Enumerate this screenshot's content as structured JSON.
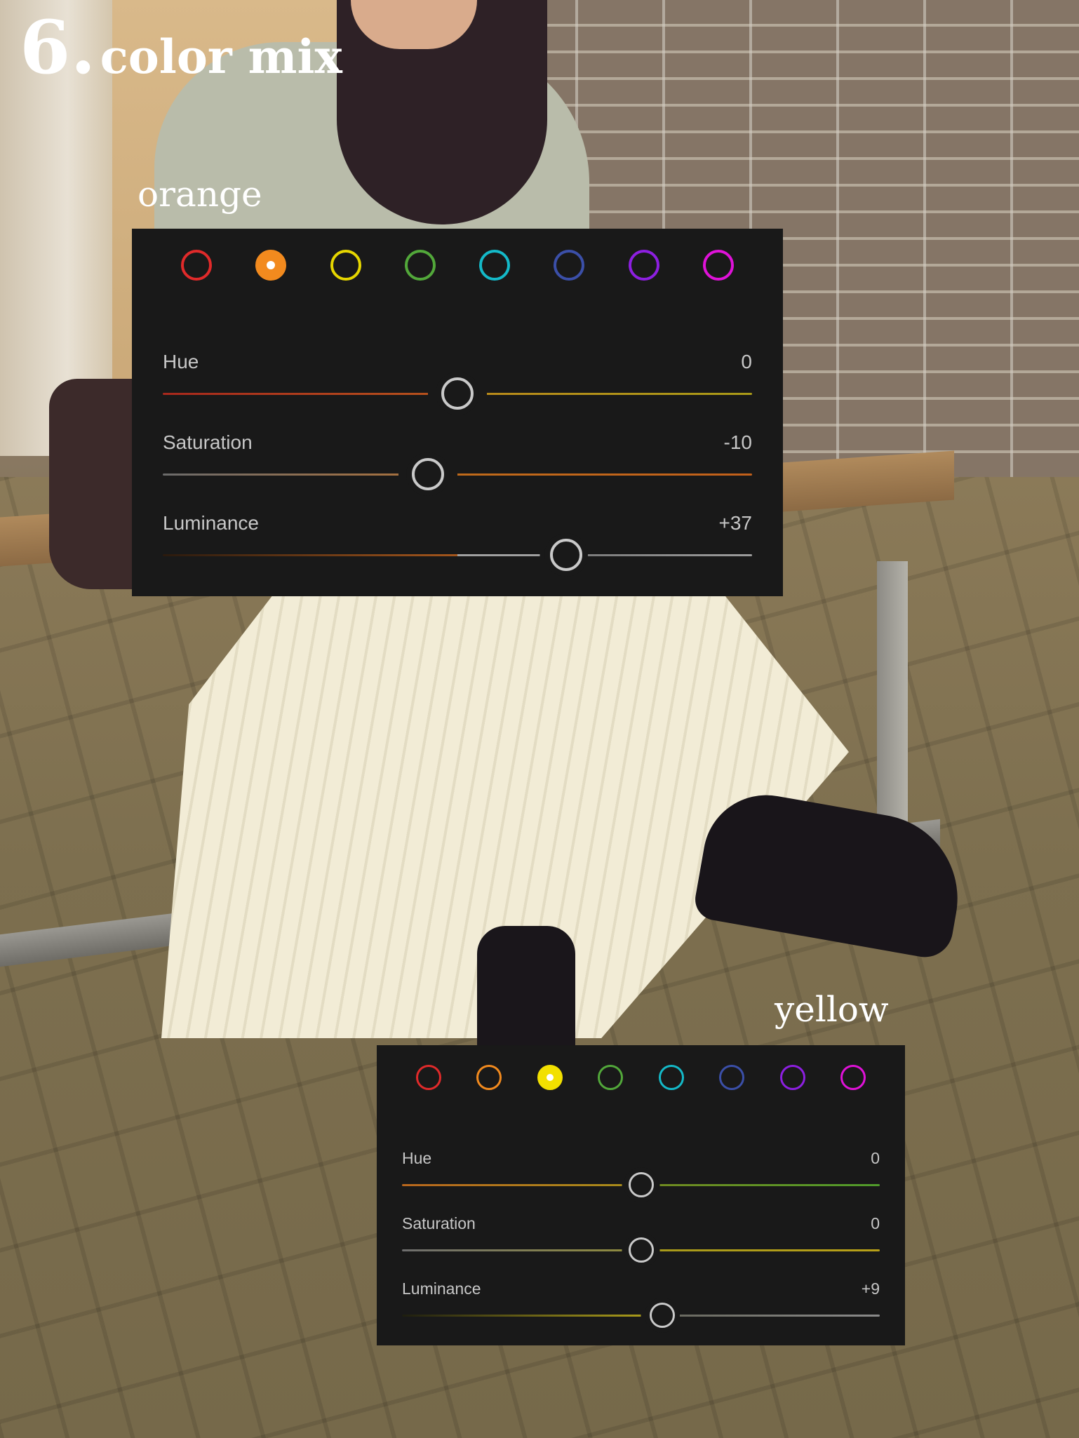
{
  "heading": {
    "number": "6.",
    "text": "color mix"
  },
  "panels": [
    {
      "label": "orange",
      "selected": "orange",
      "swatches": [
        {
          "name": "red",
          "color": "#e02a2a"
        },
        {
          "name": "orange",
          "color": "#f28a1e"
        },
        {
          "name": "yellow",
          "color": "#e6d600"
        },
        {
          "name": "green",
          "color": "#52a83a"
        },
        {
          "name": "aqua",
          "color": "#14b9c8"
        },
        {
          "name": "blue",
          "color": "#3b4fa8"
        },
        {
          "name": "purple",
          "color": "#8d1fe0"
        },
        {
          "name": "magenta",
          "color": "#df12d8"
        }
      ],
      "sliders": [
        {
          "label": "Hue",
          "value": "0",
          "fraction": 0.5,
          "track": "linear-gradient(90deg, #a8281c 0%, #b5501c 45%, #191919 45%, #191919 55%, #b88a1a 55%, #a99a18 100%)"
        },
        {
          "label": "Saturation",
          "value": "-10",
          "fraction": 0.45,
          "track": "linear-gradient(90deg, #6b6b6b 0%, #a47040 40%, #191919 40%, #191919 50%, #bf6a1a 50%, #c2601a 100%)"
        },
        {
          "label": "Luminance",
          "value": "+37",
          "fraction": 0.685,
          "track": "linear-gradient(90deg, #2a1a0e 0%, #a4561c 50%, #a0a0a0 50%, #a0a0a0 64%, #191919 64%, #191919 72%, #7c7c7c 72%, #9c9c9c 100%)"
        }
      ]
    },
    {
      "label": "yellow",
      "selected": "yellow",
      "swatches": [
        {
          "name": "red",
          "color": "#e02a2a"
        },
        {
          "name": "orange",
          "color": "#f28a1e"
        },
        {
          "name": "yellow",
          "color": "#f2e000"
        },
        {
          "name": "green",
          "color": "#52a83a"
        },
        {
          "name": "aqua",
          "color": "#14b9c8"
        },
        {
          "name": "blue",
          "color": "#3b4fa8"
        },
        {
          "name": "purple",
          "color": "#8d1fe0"
        },
        {
          "name": "magenta",
          "color": "#df12d8"
        }
      ],
      "sliders": [
        {
          "label": "Hue",
          "value": "0",
          "fraction": 0.5,
          "track": "linear-gradient(90deg, #b8661c 0%, #a88a1a 46%, #191919 46%, #191919 54%, #6f8a20 54%, #4f9a2a 100%)"
        },
        {
          "label": "Saturation",
          "value": "0",
          "fraction": 0.5,
          "track": "linear-gradient(90deg, #6e6e6e 0%, #8e8a40 46%, #191919 46%, #191919 54%, #a89a1a 54%, #b8a018 100%)"
        },
        {
          "label": "Luminance",
          "value": "+9",
          "fraction": 0.545,
          "track": "linear-gradient(90deg, #1e1e10 0%, #a89a1a 50%, #191919 50%, #191919 58%, #6a6a60 58%, #8a8a8a 100%)"
        }
      ]
    }
  ]
}
